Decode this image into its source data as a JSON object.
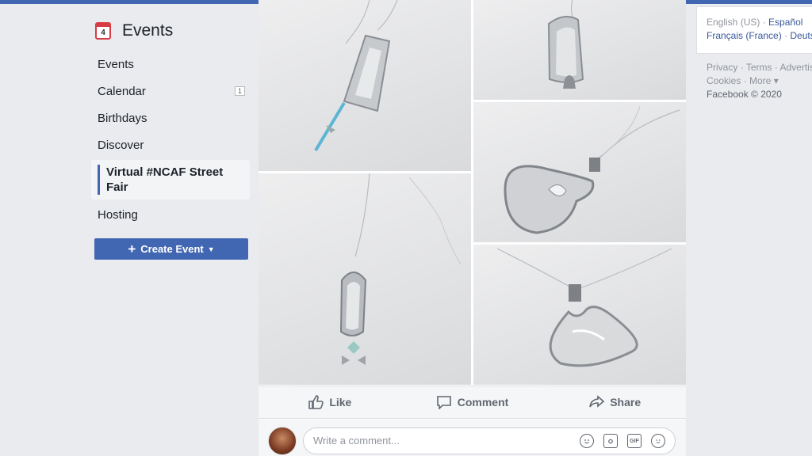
{
  "sidebar": {
    "title": "Events",
    "calendar_icon_day": "4",
    "items": [
      {
        "label": "Events"
      },
      {
        "label": "Calendar",
        "count": "1"
      },
      {
        "label": "Birthdays"
      },
      {
        "label": "Discover"
      },
      {
        "label": "Virtual #NCAF Street Fair"
      },
      {
        "label": "Hosting"
      }
    ],
    "create_button": {
      "plus": "+",
      "label": "Create Event",
      "caret": "▼"
    }
  },
  "post": {
    "actions": {
      "like": "Like",
      "comment": "Comment",
      "share": "Share"
    },
    "comment_placeholder": "Write a comment...",
    "comment_icons": [
      "emoji-icon",
      "camera-icon",
      "gif-icon",
      "sticker-icon"
    ],
    "gif_label": "GIF"
  },
  "right": {
    "languages": {
      "current": "English (US)",
      "sep": "·",
      "lang1": "Español",
      "lang2": "Français (France)",
      "lang3": "Deutsch"
    },
    "footer": {
      "privacy": "Privacy",
      "terms": "Terms",
      "advertising": "Advertising",
      "cookies": "Cookies",
      "more": "More",
      "copyright": "Facebook © 2020"
    }
  },
  "colors": {
    "brand": "#4267b2",
    "active_indicator": "#4267b2",
    "link": "#385898"
  }
}
